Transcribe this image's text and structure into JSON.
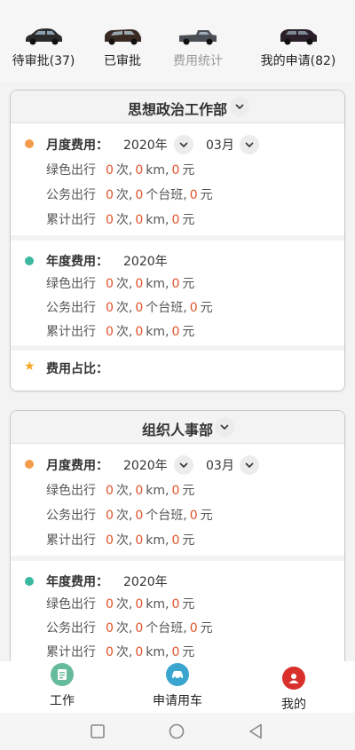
{
  "tabs": [
    {
      "label": "待审批(37)",
      "active": true
    },
    {
      "label": "已审批",
      "active": true
    },
    {
      "label": "费用统计",
      "active": false
    },
    {
      "label": "我的申请(82)",
      "active": true
    }
  ],
  "departments": [
    {
      "name": "思想政治工作部",
      "monthly": {
        "label": "月度费用：",
        "year": "2020年",
        "month": "03月",
        "green": {
          "label": "绿色出行",
          "count": "0",
          "count_unit": "次,",
          "km": "0",
          "km_unit": "km,",
          "yuan": "0",
          "yuan_unit": "元"
        },
        "official": {
          "label": "公务出行",
          "count": "0",
          "count_unit": "次,",
          "shifts": "0",
          "shifts_unit": "个台班,",
          "yuan": "0",
          "yuan_unit": "元"
        },
        "total": {
          "label": "累计出行",
          "count": "0",
          "count_unit": "次,",
          "km": "0",
          "km_unit": "km,",
          "yuan": "0",
          "yuan_unit": "元"
        }
      },
      "annual": {
        "label": "年度费用：",
        "year": "2020年",
        "green": {
          "label": "绿色出行",
          "count": "0",
          "count_unit": "次,",
          "km": "0",
          "km_unit": "km,",
          "yuan": "0",
          "yuan_unit": "元"
        },
        "official": {
          "label": "公务出行",
          "count": "0",
          "count_unit": "次,",
          "shifts": "0",
          "shifts_unit": "个台班,",
          "yuan": "0",
          "yuan_unit": "元"
        },
        "total": {
          "label": "累计出行",
          "count": "0",
          "count_unit": "次,",
          "km": "0",
          "km_unit": "km,",
          "yuan": "0",
          "yuan_unit": "元"
        }
      },
      "ratio_label": "费用占比："
    },
    {
      "name": "组织人事部",
      "monthly": {
        "label": "月度费用：",
        "year": "2020年",
        "month": "03月",
        "green": {
          "label": "绿色出行",
          "count": "0",
          "count_unit": "次,",
          "km": "0",
          "km_unit": "km,",
          "yuan": "0",
          "yuan_unit": "元"
        },
        "official": {
          "label": "公务出行",
          "count": "0",
          "count_unit": "次,",
          "shifts": "0",
          "shifts_unit": "个台班,",
          "yuan": "0",
          "yuan_unit": "元"
        },
        "total": {
          "label": "累计出行",
          "count": "0",
          "count_unit": "次,",
          "km": "0",
          "km_unit": "km,",
          "yuan": "0",
          "yuan_unit": "元"
        }
      },
      "annual": {
        "label": "年度费用：",
        "year": "2020年",
        "green": {
          "label": "绿色出行",
          "count": "0",
          "count_unit": "次,",
          "km": "0",
          "km_unit": "km,",
          "yuan": "0",
          "yuan_unit": "元"
        },
        "official": {
          "label": "公务出行",
          "count": "0",
          "count_unit": "次,",
          "shifts": "0",
          "shifts_unit": "个台班,",
          "yuan": "0",
          "yuan_unit": "元"
        },
        "total": {
          "label": "累计出行",
          "count": "0",
          "count_unit": "次,",
          "km": "0",
          "km_unit": "km,",
          "yuan": "0",
          "yuan_unit": "元"
        }
      }
    }
  ],
  "bottom_nav": [
    {
      "label": "工作",
      "icon": "work-icon",
      "color": "#66bb9a"
    },
    {
      "label": "申请用车",
      "icon": "car-icon",
      "color": "#3aa6d0"
    },
    {
      "label": "我的",
      "icon": "user-icon",
      "color": "#d9302c"
    }
  ],
  "colors": {
    "monthly_dot": "#f39a4b",
    "annual_dot": "#3bb9a0",
    "number": "#e0532b",
    "star": "#f5a623"
  }
}
